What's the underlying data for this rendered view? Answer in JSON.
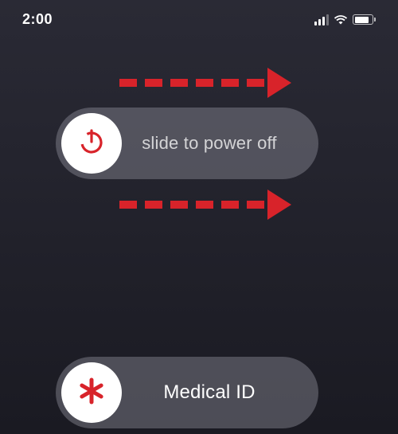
{
  "statusBar": {
    "time": "2:00"
  },
  "powerSlider": {
    "label": "slide to power off"
  },
  "medicalSlider": {
    "label": "Medical ID"
  },
  "colors": {
    "accent": "#d8232a"
  }
}
